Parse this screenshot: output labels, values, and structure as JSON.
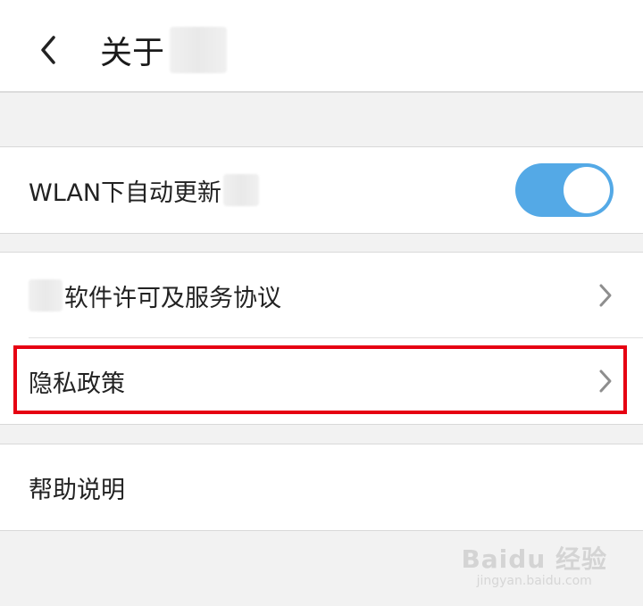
{
  "header": {
    "title": "关于"
  },
  "settings": {
    "auto_update": {
      "label": "WLAN下自动更新",
      "enabled": true
    },
    "links": [
      {
        "label": "软件许可及服务协议"
      },
      {
        "label": "隐私政策"
      }
    ],
    "help": {
      "label": "帮助说明"
    }
  },
  "watermark": {
    "main": "Baidu 经验",
    "sub": "jingyan.baidu.com"
  },
  "colors": {
    "toggle_on": "#54a9e6",
    "highlight": "#e60012",
    "background": "#f2f2f2"
  },
  "icons": {
    "back": "chevron-left-icon",
    "row_arrow": "chevron-right-icon"
  }
}
